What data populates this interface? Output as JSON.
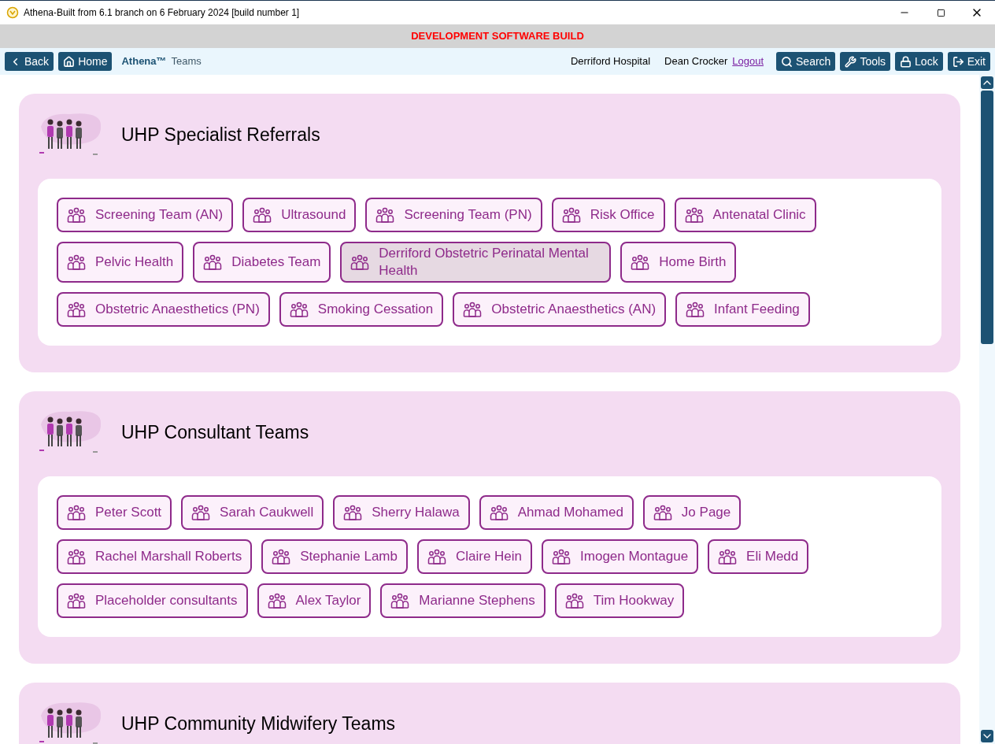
{
  "window": {
    "title": "Athena-Built from 6.1 branch on 6 February 2024 [build number 1]"
  },
  "banner": "DEVELOPMENT SOFTWARE BUILD",
  "nav": {
    "back": "Back",
    "home": "Home",
    "brand": "Athena™",
    "page": "Teams",
    "location": "Derriford Hospital",
    "user": "Dean Crocker",
    "logout": "Logout",
    "actions": [
      {
        "kind": "search",
        "label": "Search"
      },
      {
        "kind": "tools",
        "label": "Tools"
      },
      {
        "kind": "lock",
        "label": "Lock"
      },
      {
        "kind": "exit",
        "label": "Exit"
      }
    ]
  },
  "sections": [
    {
      "title": "UHP Specialist Referrals",
      "teams": [
        {
          "label": "Screening Team (AN)",
          "highlighted": false
        },
        {
          "label": "Ultrasound",
          "highlighted": false
        },
        {
          "label": "Screening Team (PN)",
          "highlighted": false
        },
        {
          "label": "Risk Office",
          "highlighted": false
        },
        {
          "label": "Antenatal Clinic",
          "highlighted": false
        },
        {
          "label": "Pelvic Health",
          "highlighted": false
        },
        {
          "label": "Diabetes Team",
          "highlighted": false
        },
        {
          "label": "Derriford Obstetric Perinatal Mental Health",
          "highlighted": true
        },
        {
          "label": "Home Birth",
          "highlighted": false
        },
        {
          "label": "Obstetric Anaesthetics (PN)",
          "highlighted": false
        },
        {
          "label": "Smoking Cessation",
          "highlighted": false
        },
        {
          "label": "Obstetric Anaesthetics (AN)",
          "highlighted": false
        },
        {
          "label": "Infant Feeding",
          "highlighted": false
        }
      ]
    },
    {
      "title": "UHP Consultant Teams",
      "teams": [
        {
          "label": "Peter Scott",
          "highlighted": false
        },
        {
          "label": "Sarah Caukwell",
          "highlighted": false
        },
        {
          "label": "Sherry Halawa",
          "highlighted": false
        },
        {
          "label": "Ahmad Mohamed",
          "highlighted": false
        },
        {
          "label": "Jo Page",
          "highlighted": false
        },
        {
          "label": "Rachel Marshall Roberts",
          "highlighted": false
        },
        {
          "label": "Stephanie Lamb",
          "highlighted": false
        },
        {
          "label": "Claire Hein",
          "highlighted": false
        },
        {
          "label": "Imogen Montague",
          "highlighted": false
        },
        {
          "label": "Eli Medd",
          "highlighted": false
        },
        {
          "label": "Placeholder consultants",
          "highlighted": false
        },
        {
          "label": "Alex Taylor",
          "highlighted": false
        },
        {
          "label": "Marianne Stephens",
          "highlighted": false
        },
        {
          "label": "Tim Hookway",
          "highlighted": false
        }
      ]
    },
    {
      "title": "UHP Community Midwifery Teams"
    }
  ]
}
